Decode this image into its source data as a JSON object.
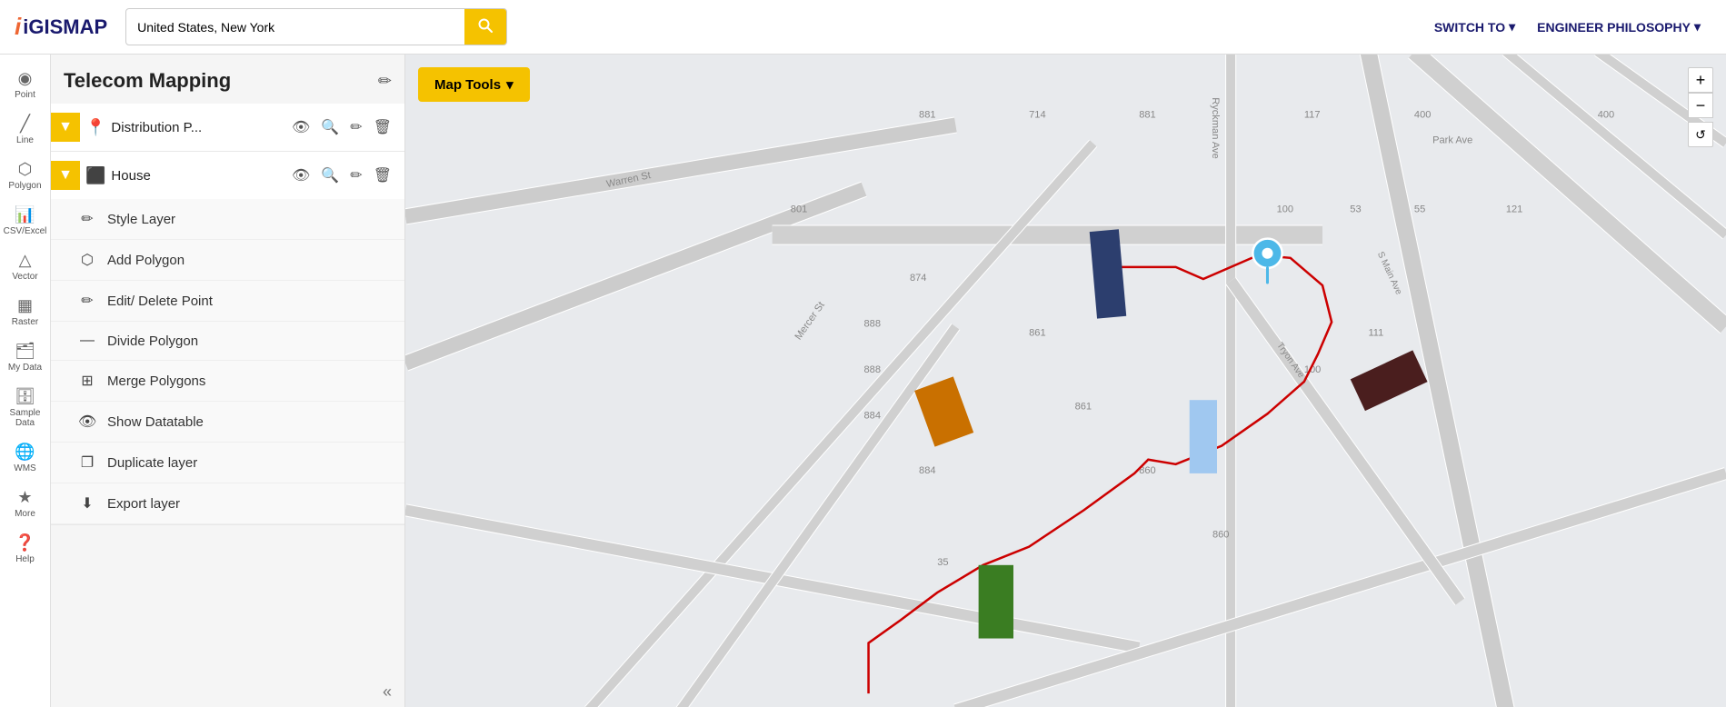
{
  "header": {
    "logo_text": "iGISMAP",
    "search_placeholder": "United States, New York",
    "search_value": "United States, New York",
    "switch_to_label": "SWITCH TO",
    "engineer_label": "ENGINEER PHILOSOPHY"
  },
  "sidebar": {
    "title": "Telecom Mapping",
    "layers": [
      {
        "id": "layer1",
        "name": "Distribution P...",
        "icon": "📍",
        "expanded": true
      },
      {
        "id": "layer2",
        "name": "House",
        "icon": "⬛",
        "expanded": true
      }
    ],
    "submenu_items": [
      {
        "id": "style",
        "icon": "✏",
        "label": "Style Layer"
      },
      {
        "id": "addpolygon",
        "icon": "⬡",
        "label": "Add Polygon"
      },
      {
        "id": "editdelete",
        "icon": "✏",
        "label": "Edit/ Delete Point"
      },
      {
        "id": "divide",
        "icon": "—",
        "label": "Divide Polygon"
      },
      {
        "id": "merge",
        "icon": "⊞",
        "label": "Merge Polygons"
      },
      {
        "id": "datatable",
        "icon": "👁",
        "label": "Show Datatable"
      },
      {
        "id": "duplicate",
        "icon": "❐",
        "label": "Duplicate layer"
      },
      {
        "id": "export",
        "icon": "⬇",
        "label": "Export layer"
      }
    ]
  },
  "toolbar": {
    "items": [
      {
        "id": "point",
        "icon": "📍",
        "label": "Point"
      },
      {
        "id": "line",
        "icon": "📈",
        "label": "Line"
      },
      {
        "id": "polygon",
        "icon": "⬡",
        "label": "Polygon"
      },
      {
        "id": "csvexcel",
        "icon": "📊",
        "label": "CSV/Excel"
      },
      {
        "id": "vector",
        "icon": "△",
        "label": "Vector"
      },
      {
        "id": "raster",
        "icon": "▦",
        "label": "Raster"
      },
      {
        "id": "mydata",
        "icon": "🗂",
        "label": "My Data"
      },
      {
        "id": "sampledata",
        "icon": "🗄",
        "label": "Sample Data"
      },
      {
        "id": "wms",
        "icon": "🌐",
        "label": "WMS"
      },
      {
        "id": "more",
        "icon": "★",
        "label": "More"
      },
      {
        "id": "help",
        "icon": "❓",
        "label": "Help"
      }
    ]
  },
  "map": {
    "tools_label": "Map Tools",
    "zoom_in": "+",
    "zoom_out": "−",
    "zoom_reset": "↺"
  },
  "colors": {
    "yellow": "#f5c200",
    "dark_blue": "#1a1a6e",
    "red": "#cc0000",
    "light_blue_pin": "#4db8e8"
  }
}
